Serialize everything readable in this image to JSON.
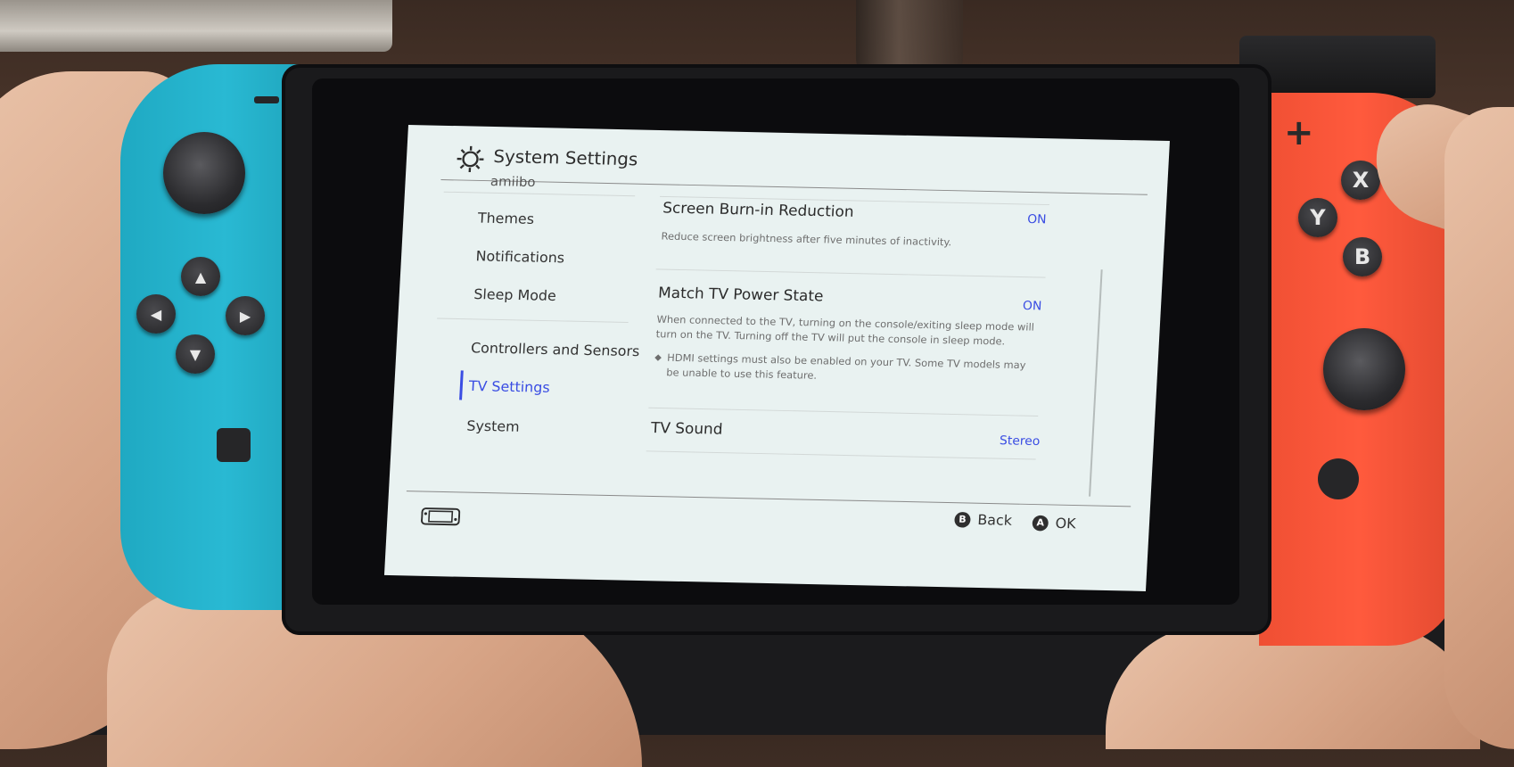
{
  "header": {
    "title": "System Settings",
    "icon": "gear-icon"
  },
  "sidebar": {
    "cut_off_item": "amiibo",
    "items": [
      {
        "label": "Themes"
      },
      {
        "label": "Notifications"
      },
      {
        "label": "Sleep Mode"
      },
      {
        "label": "Controllers and Sensors"
      },
      {
        "label": "TV Settings",
        "selected": true
      },
      {
        "label": "System"
      }
    ]
  },
  "settings": [
    {
      "title": "Screen Burn-in Reduction",
      "value": "ON",
      "description": "Reduce screen brightness after five minutes of inactivity."
    },
    {
      "title": "Match TV Power State",
      "value": "ON",
      "description": "When connected to the TV, turning on the console/exiting sleep mode will turn on the TV. Turning off the TV will put the console in sleep mode.",
      "note": "HDMI settings must also be enabled on your TV. Some TV models may be unable to use this feature."
    },
    {
      "title": "TV Sound",
      "value": "Stereo"
    }
  ],
  "footer": {
    "back": {
      "glyph": "B",
      "label": "Back"
    },
    "ok": {
      "glyph": "A",
      "label": "OK"
    }
  },
  "controller_buttons": {
    "x": "X",
    "y": "Y",
    "b": "B",
    "plus": "+"
  },
  "colors": {
    "accent": "#3a4de3",
    "left_joycon": "#29b9d3",
    "right_joycon": "#ff5a3d"
  }
}
